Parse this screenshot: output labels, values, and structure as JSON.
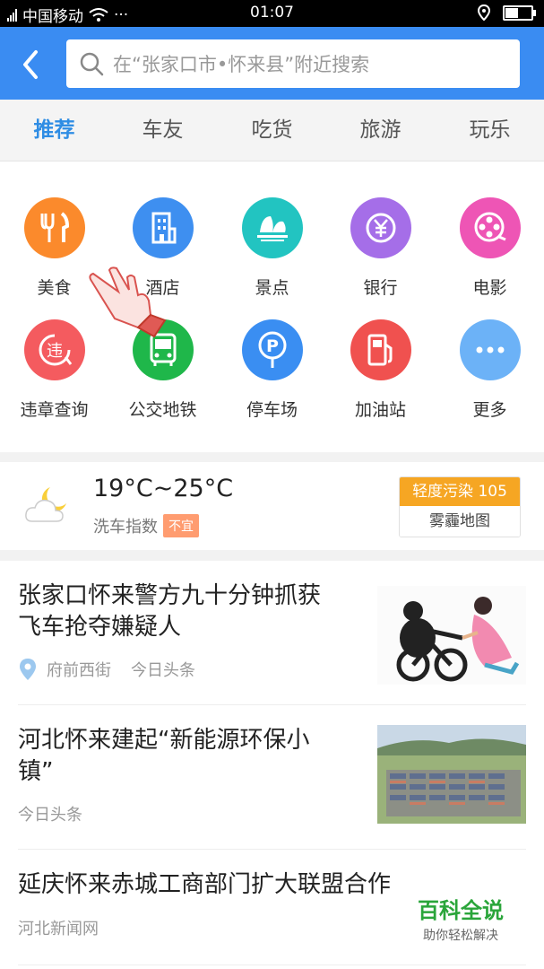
{
  "status_bar": {
    "carrier": "中国移动",
    "dots": "···",
    "time": "01:07"
  },
  "search": {
    "placeholder": "在“张家口市•怀来县”附近搜索"
  },
  "tabs": [
    {
      "label": "推荐",
      "active": true
    },
    {
      "label": "车友"
    },
    {
      "label": "吃货"
    },
    {
      "label": "旅游"
    },
    {
      "label": "玩乐"
    }
  ],
  "categories": [
    {
      "label": "美食",
      "icon": "fork-knife-icon",
      "color": "#fb8a2c"
    },
    {
      "label": "酒店",
      "icon": "hotel-building-icon",
      "color": "#3e8ff0"
    },
    {
      "label": "景点",
      "icon": "scenic-spot-icon",
      "color": "#22c4c1"
    },
    {
      "label": "银行",
      "icon": "yuan-coin-icon",
      "color": "#a56ee8"
    },
    {
      "label": "电影",
      "icon": "film-reel-icon",
      "color": "#ee55b5"
    },
    {
      "label": "违章查询",
      "icon": "violation-icon",
      "color": "#f45b5f",
      "glyph": "违"
    },
    {
      "label": "公交地铁",
      "icon": "bus-icon",
      "color": "#1fb74a"
    },
    {
      "label": "停车场",
      "icon": "parking-icon",
      "color": "#3a8ef2",
      "glyph": "P"
    },
    {
      "label": "加油站",
      "icon": "gas-station-icon",
      "color": "#f0514f"
    },
    {
      "label": "更多",
      "icon": "more-dots-icon",
      "color": "#6cb2f7"
    }
  ],
  "weather": {
    "temp": "19°C~25°C",
    "car_wash_label": "洗车指数",
    "car_wash_value": "不宜",
    "aqi_label": "轻度污染",
    "aqi_value": "105",
    "haze_map": "雾霾地图"
  },
  "news": [
    {
      "title_line1": "张家口怀来警方九十分钟抓获",
      "title_line2": "飞车抢夺嫌疑人",
      "location": "府前西街",
      "source": "今日头条"
    },
    {
      "title_line1": "河北怀来建起“新能源环保小",
      "title_line2": "镇”",
      "source": "今日头条"
    },
    {
      "title_line1": "延庆怀来赤城工商部门扩大联盟合作",
      "source": "河北新闻网"
    }
  ],
  "watermark": {
    "title": "百科全说",
    "subtitle": "助你轻松解决"
  }
}
